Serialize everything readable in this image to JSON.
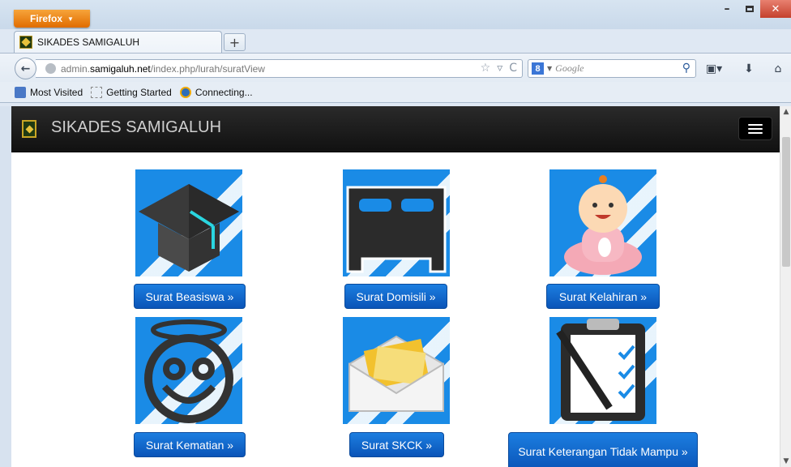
{
  "browser": {
    "menu_label": "Firefox",
    "tab_title": "SIKADES SAMIGALUH",
    "new_tab_label": "+",
    "url_prefix": "admin.",
    "url_domain": "samigaluh.net",
    "url_path": "/index.php/lurah/suratView",
    "search_placeholder": "Google",
    "search_engine_letter": "8",
    "bookmarks": [
      "Most Visited",
      "Getting Started",
      "Connecting..."
    ]
  },
  "site": {
    "title": "SIKADES SAMIGALUH"
  },
  "cards": [
    {
      "icon": "graduation-cap-icon",
      "label": "Surat Beasiswa »"
    },
    {
      "icon": "bed-icon",
      "label": "Surat Domisili »"
    },
    {
      "icon": "baby-icon",
      "label": "Surat Kelahiran »"
    },
    {
      "icon": "halo-face-icon",
      "label": "Surat Kematian »"
    },
    {
      "icon": "open-envelope-icon",
      "label": "Surat SKCK »"
    },
    {
      "icon": "clipboard-checklist-icon",
      "label": "Surat Keterangan Tidak Mampu »"
    }
  ],
  "colors": {
    "accent_button": "#0a54b8",
    "icon_background": "#1a8be6",
    "navbar": "#1a1a1a"
  }
}
